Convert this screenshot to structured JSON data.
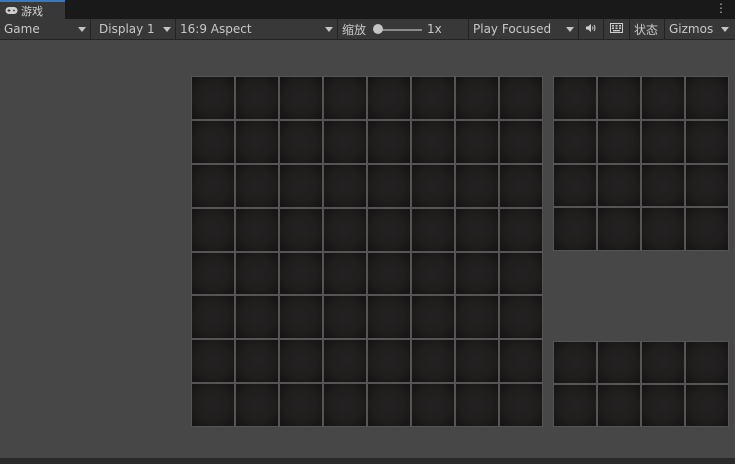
{
  "tab": {
    "icon": "gamepad-icon",
    "title": "游戏"
  },
  "toolbar": {
    "view_mode": "Game",
    "display": "Display 1",
    "aspect": "16:9 Aspect",
    "scale_label": "缩放",
    "scale_value": "1x",
    "play_mode": "Play Focused",
    "audio_icon": "speaker-icon",
    "stats_icon": "keyboard-icon",
    "stats_label": "状态",
    "gizmos_label": "Gizmos"
  },
  "colors": {
    "panel": "#383838",
    "viewport": "#474747",
    "cell": "#201d1d",
    "accent": "#3a79bb"
  },
  "grids": [
    {
      "name": "main-board",
      "rows": 8,
      "cols": 8
    },
    {
      "name": "side-panel-top",
      "rows": 4,
      "cols": 4
    },
    {
      "name": "side-panel-bottom",
      "rows": 2,
      "cols": 4
    }
  ]
}
